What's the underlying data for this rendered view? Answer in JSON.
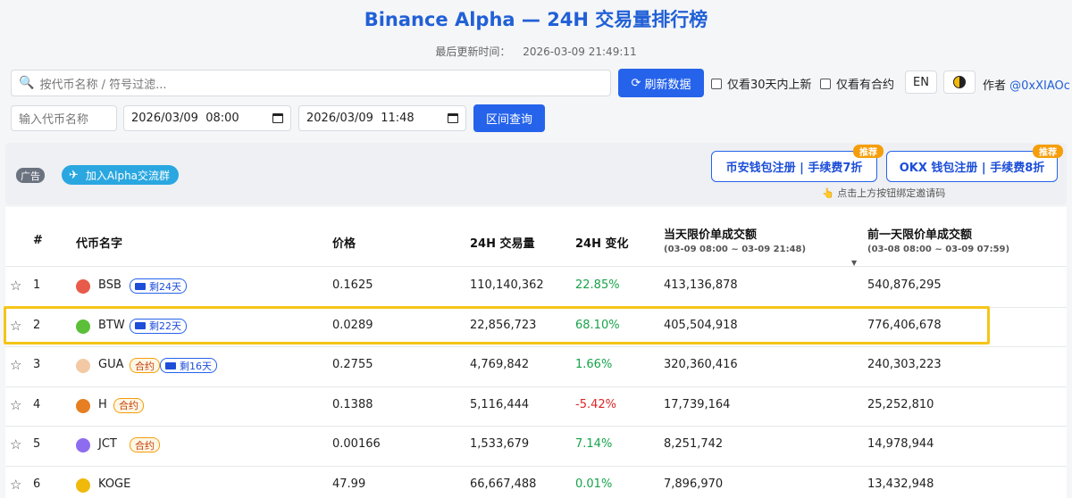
{
  "header": {
    "title": "Binance Alpha — 24H 交易量排行榜",
    "updated_label": "最后更新时间：",
    "updated_value": "2026-03-09 21:49:11"
  },
  "toolbar": {
    "search_placeholder": "按代币名称 / 符号过滤...",
    "refresh_label": "刷新数据",
    "new30_label": "仅看30天内上新",
    "contract_label": "仅看有合约",
    "lang_label": "EN",
    "author_label": "作者",
    "author_handle": "@0xXIAOc"
  },
  "range_query": {
    "token_placeholder": "输入代币名称",
    "start_value": "2026/03/09  08:00",
    "end_value": "2026/03/09  11:48",
    "query_label": "区间查询"
  },
  "ad": {
    "tag": "广告",
    "group_label": "加入Alpha交流群",
    "binance_label": "币安钱包注册 | 手续费7折",
    "okx_label": "OKX 钱包注册 | 手续费8折",
    "recommend_badge": "推荐",
    "hint": "点击上方按钮绑定邀请码"
  },
  "table": {
    "columns": {
      "rank": "#",
      "name": "代币名字",
      "price": "价格",
      "volume": "24H 交易量",
      "change": "24H 变化",
      "today_limit": "当天限价单成交额",
      "today_range": "(03-09 08:00 ~ 03-09 21:48)",
      "prev_limit": "前一天限价单成交额",
      "prev_range": "(03-08 08:00 ~ 03-09 07:59)"
    },
    "rows": [
      {
        "rank": "1",
        "symbol": "BSB",
        "contract": "",
        "days": "剩24天",
        "price": "0.1625",
        "volume": "110,140,362",
        "change": "22.85%",
        "direction": "pos",
        "today": "413,136,878",
        "prev": "540,876,295",
        "icon_color": "#e85b4b"
      },
      {
        "rank": "2",
        "symbol": "BTW",
        "contract": "",
        "days": "剩22天",
        "price": "0.0289",
        "volume": "22,856,723",
        "change": "68.10%",
        "direction": "pos",
        "today": "405,504,918",
        "prev": "776,406,678",
        "icon_color": "#5bbf3a"
      },
      {
        "rank": "3",
        "symbol": "GUA",
        "contract": "合约",
        "days": "剩16天",
        "price": "0.2755",
        "volume": "4,769,842",
        "change": "1.66%",
        "direction": "pos",
        "today": "320,360,416",
        "prev": "240,303,223",
        "icon_color": "#f2c9a4"
      },
      {
        "rank": "4",
        "symbol": "H",
        "contract": "合约",
        "days": "",
        "price": "0.1388",
        "volume": "5,116,444",
        "change": "-5.42%",
        "direction": "neg",
        "today": "17,739,164",
        "prev": "25,252,810",
        "icon_color": "#e67e22"
      },
      {
        "rank": "5",
        "symbol": "JCT",
        "contract": "合约",
        "days": "",
        "price": "0.00166",
        "volume": "1,533,679",
        "change": "7.14%",
        "direction": "pos",
        "today": "8,251,742",
        "prev": "14,978,944",
        "icon_color": "#8e6cf0"
      },
      {
        "rank": "6",
        "symbol": "KOGE",
        "contract": "",
        "days": "",
        "price": "47.99",
        "volume": "66,667,488",
        "change": "0.01%",
        "direction": "pos",
        "today": "7,896,970",
        "prev": "13,432,948",
        "icon_color": "#f0b90b"
      }
    ],
    "highlighted_rank": "2"
  }
}
